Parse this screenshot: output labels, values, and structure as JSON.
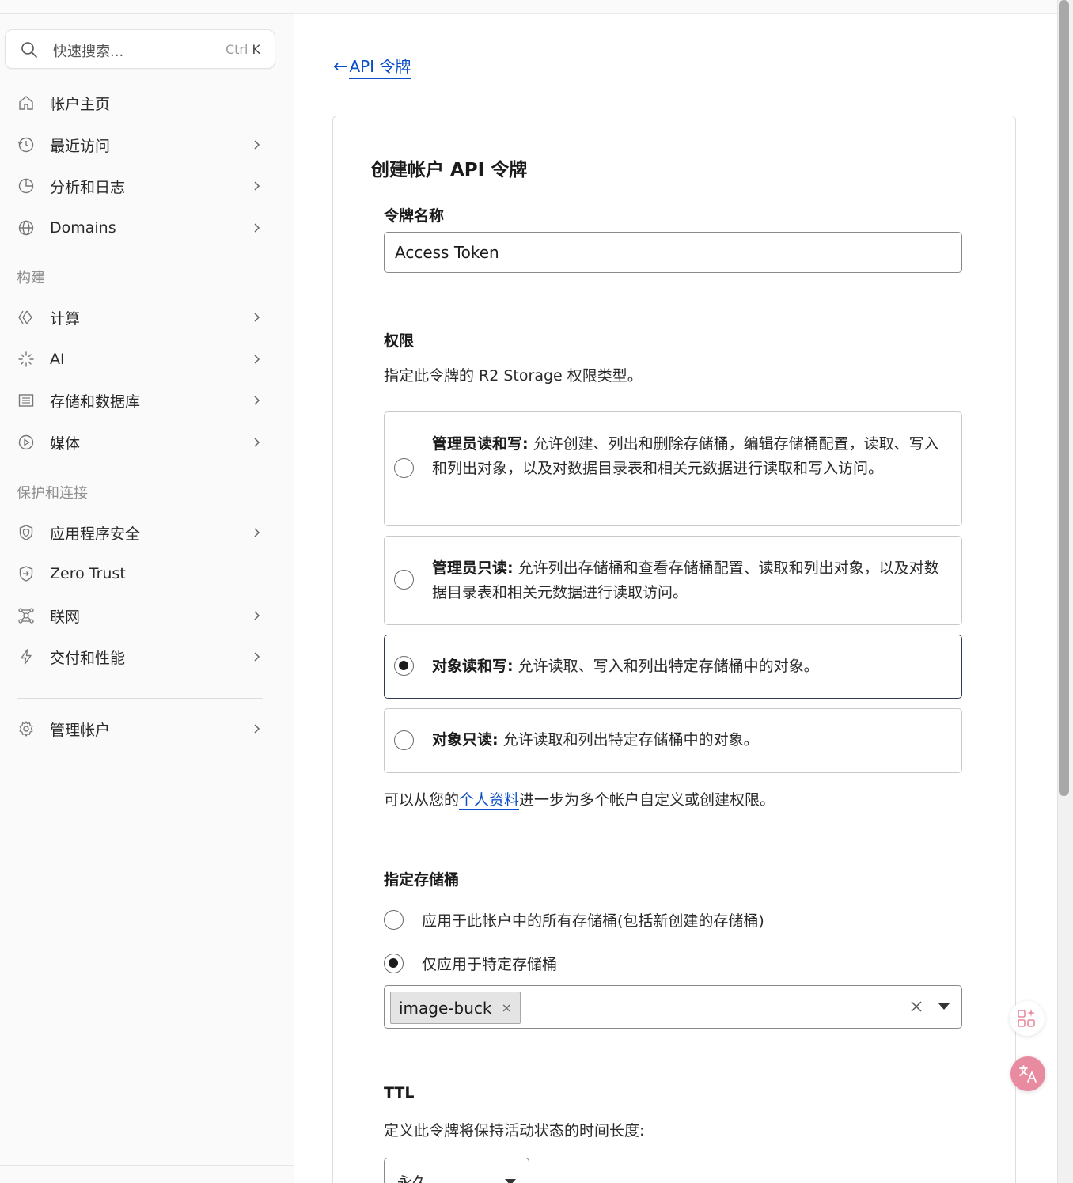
{
  "search": {
    "placeholder": "快速搜索...",
    "shortcut_ctrl": "Ctrl",
    "shortcut_key": "K"
  },
  "sidebar": {
    "items": [
      {
        "label": "帐户主页",
        "icon": "home-icon"
      },
      {
        "label": "最近访问",
        "icon": "history-icon"
      },
      {
        "label": "分析和日志",
        "icon": "pie-chart-icon"
      },
      {
        "label": "Domains",
        "icon": "globe-icon"
      },
      {
        "label": "计算",
        "icon": "compute-icon"
      },
      {
        "label": "AI",
        "icon": "sparkle-icon"
      },
      {
        "label": "存储和数据库",
        "icon": "database-icon"
      },
      {
        "label": "媒体",
        "icon": "play-icon"
      },
      {
        "label": "应用程序安全",
        "icon": "shield-icon"
      },
      {
        "label": "Zero Trust",
        "icon": "zero-trust-icon"
      },
      {
        "label": "联网",
        "icon": "network-icon"
      },
      {
        "label": "交付和性能",
        "icon": "bolt-icon"
      },
      {
        "label": "管理帐户",
        "icon": "gear-icon"
      }
    ],
    "sections": {
      "build": "构建",
      "protect": "保护和连接"
    }
  },
  "main": {
    "back_label": "API 令牌",
    "title": "创建帐户 API 令牌",
    "token_name": {
      "label": "令牌名称",
      "value": "Access Token"
    },
    "permissions": {
      "label": "权限",
      "description": "指定此令牌的 R2 Storage 权限类型。",
      "options": [
        {
          "title": "管理员读和写:",
          "desc": "允许创建、列出和删除存储桶，编辑存储桶配置，读取、写入和列出对象，以及对数据目录表和相关元数据进行读取和写入访问。",
          "selected": false
        },
        {
          "title": "管理员只读:",
          "desc": "允许列出存储桶和查看存储桶配置、读取和列出对象，以及对数据目录表和相关元数据进行读取访问。",
          "selected": false
        },
        {
          "title": "对象读和写:",
          "desc": "允许读取、写入和列出特定存储桶中的对象。",
          "selected": true
        },
        {
          "title": "对象只读:",
          "desc": "允许读取和列出特定存储桶中的对象。",
          "selected": false
        }
      ],
      "profile_note_prefix": "可以从您的",
      "profile_link": "个人资料",
      "profile_note_suffix": "进一步为多个帐户自定义或创建权限。"
    },
    "buckets": {
      "label": "指定存储桶",
      "option_all": "应用于此帐户中的所有存储桶(包括新创建的存储桶)",
      "option_specific": "仅应用于特定存储桶",
      "selected_chip": "image-buck",
      "chip_remove": "×"
    },
    "ttl": {
      "label": "TTL",
      "description": "定义此令牌将保持活动状态的时间长度:",
      "value": "永久"
    }
  },
  "colors": {
    "link": "#0b4fc8",
    "translate_button": "#e88aa0"
  }
}
